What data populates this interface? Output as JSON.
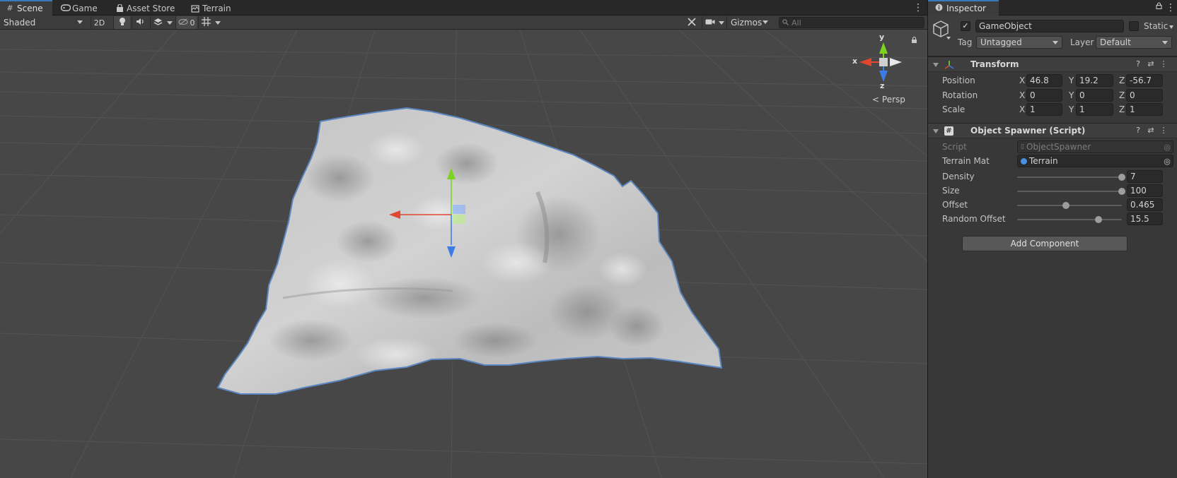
{
  "scene_tabs": [
    {
      "label": "Scene",
      "icon": "grid-icon"
    },
    {
      "label": "Game",
      "icon": "gamepad-icon"
    },
    {
      "label": "Asset Store",
      "icon": "bag-icon"
    },
    {
      "label": "Terrain",
      "icon": "terrain-icon"
    }
  ],
  "toolbar": {
    "shading_mode": "Shaded",
    "mode_2d": "2D",
    "hidden_count": "0",
    "gizmos_label": "Gizmos",
    "search_placeholder": "All"
  },
  "viewport": {
    "projection_label": "Persp",
    "axis_labels": {
      "x": "x",
      "y": "y",
      "z": "z"
    },
    "colors": {
      "x_axis": "#e0472f",
      "y_axis": "#7ed321",
      "z_axis": "#3d7be6",
      "selection_outline": "#5b86c0"
    }
  },
  "inspector": {
    "tab_label": "Inspector",
    "object": {
      "active": true,
      "name": "GameObject",
      "static_label": "Static",
      "static_checked": false,
      "tag_label": "Tag",
      "tag_value": "Untagged",
      "layer_label": "Layer",
      "layer_value": "Default"
    },
    "transform": {
      "title": "Transform",
      "rows": [
        {
          "label": "Position",
          "x": "46.8",
          "y": "19.2",
          "z": "-56.7"
        },
        {
          "label": "Rotation",
          "x": "0",
          "y": "0",
          "z": "0"
        },
        {
          "label": "Scale",
          "x": "1",
          "y": "1",
          "z": "1"
        }
      ]
    },
    "spawner": {
      "title": "Object Spawner (Script)",
      "script_label": "Script",
      "script_value": "ObjectSpawner",
      "terrain_mat_label": "Terrain Mat",
      "terrain_mat_value": "Terrain",
      "sliders": [
        {
          "label": "Density",
          "value": "7",
          "fraction": 1.0
        },
        {
          "label": "Size",
          "value": "100",
          "fraction": 1.0
        },
        {
          "label": "Offset",
          "value": "0.465",
          "fraction": 0.465
        },
        {
          "label": "Random Offset",
          "value": "15.5",
          "fraction": 0.775
        }
      ]
    },
    "add_component_label": "Add Component"
  }
}
